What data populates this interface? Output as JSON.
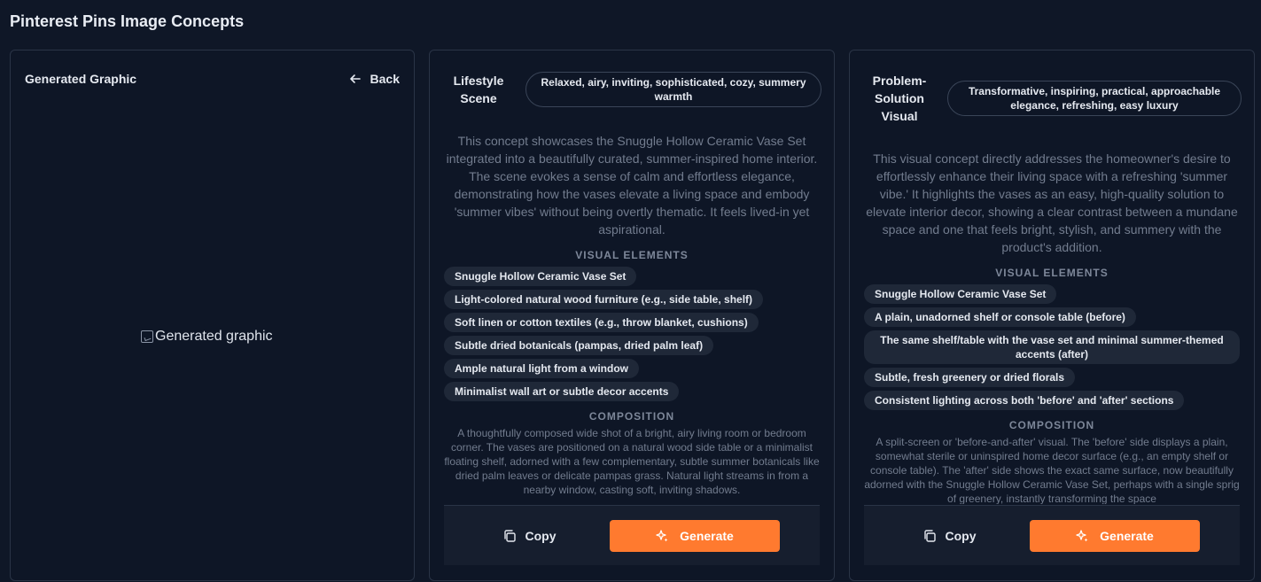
{
  "page": {
    "title": "Pinterest Pins Image Concepts"
  },
  "graphic_panel": {
    "title": "Generated Graphic",
    "back_label": "Back",
    "image_alt": "Generated graphic"
  },
  "concepts": [
    {
      "type": "Lifestyle Scene",
      "mood": "Relaxed, airy, inviting, sophisticated, cozy, summery warmth",
      "description": "This concept showcases the Snuggle Hollow Ceramic Vase Set integrated into a beautifully curated, summer-inspired home interior. The scene evokes a sense of calm and effortless elegance, demonstrating how the vases elevate a living space and embody 'summer vibes' without being overtly thematic. It feels lived-in yet aspirational.",
      "visual_elements_heading": "VISUAL ELEMENTS",
      "visual_elements": [
        "Snuggle Hollow Ceramic Vase Set",
        "Light-colored natural wood furniture (e.g., side table, shelf)",
        "Soft linen or cotton textiles (e.g., throw blanket, cushions)",
        "Subtle dried botanicals (pampas, dried palm leaf)",
        "Ample natural light from a window",
        "Minimalist wall art or subtle decor accents"
      ],
      "composition_heading": "COMPOSITION",
      "composition": "A thoughtfully composed wide shot of a bright, airy living room or bedroom corner. The vases are positioned on a natural wood side table or a minimalist floating shelf, adorned with a few complementary, subtle summer botanicals like dried palm leaves or delicate pampas grass. Natural light streams in from a nearby window, casting soft, inviting shadows.",
      "copy_label": "Copy",
      "generate_label": "Generate"
    },
    {
      "type": "Problem-Solution Visual",
      "mood": "Transformative, inspiring, practical, approachable elegance, refreshing, easy luxury",
      "description": "This visual concept directly addresses the homeowner's desire to effortlessly enhance their living space with a refreshing 'summer vibe.' It highlights the vases as an easy, high-quality solution to elevate interior decor, showing a clear contrast between a mundane space and one that feels bright, stylish, and summery with the product's addition.",
      "visual_elements_heading": "VISUAL ELEMENTS",
      "visual_elements": [
        "Snuggle Hollow Ceramic Vase Set",
        "A plain, unadorned shelf or console table (before)",
        "The same shelf/table with the vase set and minimal summer-themed accents (after)",
        "Subtle, fresh greenery or dried florals",
        "Consistent lighting across both 'before' and 'after' sections"
      ],
      "composition_heading": "COMPOSITION",
      "composition": "A split-screen or 'before-and-after' visual. The 'before' side displays a plain, somewhat sterile or uninspired home decor surface (e.g., an empty shelf or console table). The 'after' side shows the exact same surface, now beautifully adorned with the Snuggle Hollow Ceramic Vase Set, perhaps with a single sprig of greenery, instantly transforming the space",
      "copy_label": "Copy",
      "generate_label": "Generate"
    }
  ]
}
